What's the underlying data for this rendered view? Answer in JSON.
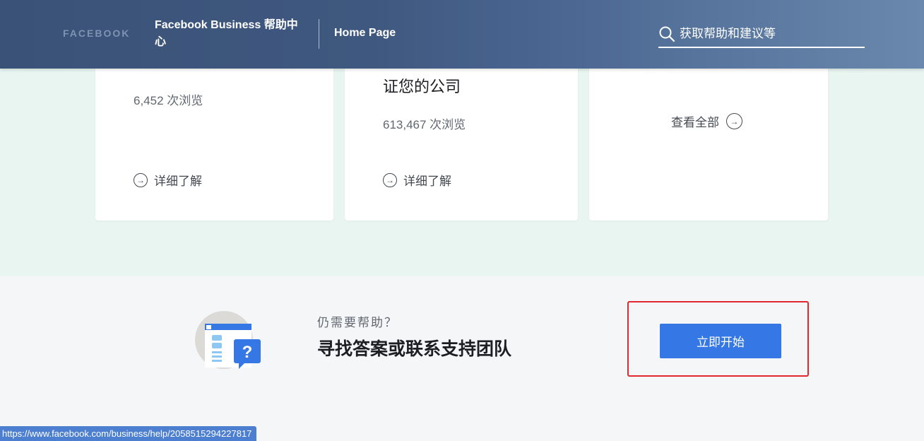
{
  "header": {
    "logo": "FACEBOOK",
    "help_center_title": "Facebook Business 帮助中心",
    "home_link": "Home Page",
    "search_placeholder": "获取帮助和建议等"
  },
  "cards": [
    {
      "title_partial": "",
      "views": "6,452 次浏览",
      "learn_more": "详细了解"
    },
    {
      "title_partial": "证您的公司",
      "views": "613,467 次浏览",
      "learn_more": "详细了解"
    },
    {
      "see_all": "查看全部"
    }
  ],
  "help_cta": {
    "still_need_help": "仍需要帮助？",
    "heading": "寻找答案或联系支持团队",
    "start_button": "立即开始"
  },
  "status_bar": {
    "url": "https://www.facebook.com/business/help/2058515294227817"
  },
  "colors": {
    "header_bg": "#3b5278",
    "mint_bg": "#e8f5f0",
    "button_blue": "#3578e5",
    "highlight_red": "#e0282e"
  }
}
